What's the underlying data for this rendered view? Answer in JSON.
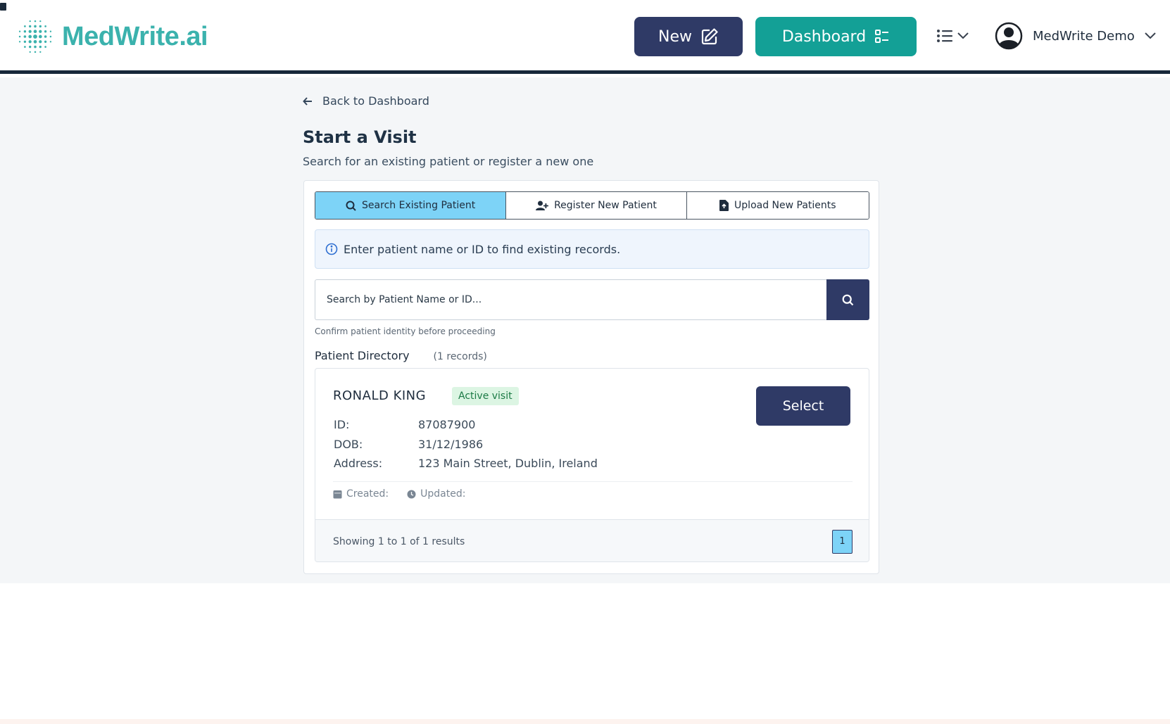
{
  "header": {
    "logo_text": "MedWrite.ai",
    "new_label": "New",
    "dashboard_label": "Dashboard",
    "user_name": "MedWrite Demo",
    "colors": {
      "brand_teal": "#3bb2ad",
      "navy": "#2f3a66",
      "dashboard_green": "#13a096"
    }
  },
  "nav": {
    "back_label": "Back to Dashboard"
  },
  "page": {
    "title": "Start a Visit",
    "subtitle": "Search for an existing patient or register a new one"
  },
  "tabs": [
    {
      "label": "Search Existing Patient",
      "icon": "search-icon",
      "active": true
    },
    {
      "label": "Register New Patient",
      "icon": "user-plus-icon",
      "active": false
    },
    {
      "label": "Upload New Patients",
      "icon": "file-upload-icon",
      "active": false
    }
  ],
  "info": {
    "message": "Enter patient name or ID to find existing records."
  },
  "search": {
    "placeholder": "Search by Patient Name or ID...",
    "hint": "Confirm patient identity before proceeding"
  },
  "directory": {
    "title": "Patient Directory",
    "count": "(1 records)",
    "patients": [
      {
        "name": "RONALD KING",
        "status": "Active visit",
        "select_label": "Select",
        "id_label": "ID:",
        "id": "87087900",
        "dob_label": "DOB:",
        "dob": "31/12/1986",
        "address_label": "Address:",
        "address": "123 Main Street, Dublin, Ireland",
        "created_label": "Created:",
        "updated_label": "Updated:"
      }
    ]
  },
  "pagination": {
    "summary": "Showing 1 to 1 of 1 results",
    "current_page": "1"
  }
}
